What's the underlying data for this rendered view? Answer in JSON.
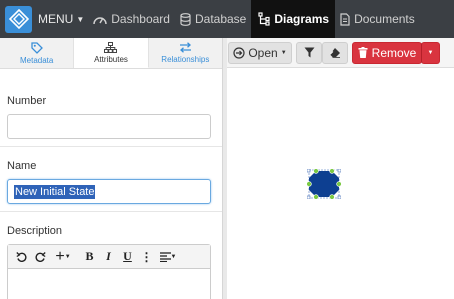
{
  "topbar": {
    "menu_label": "MENU",
    "nav": [
      {
        "label": "Dashboard",
        "icon": "dashboard-icon"
      },
      {
        "label": "Database",
        "icon": "database-icon"
      },
      {
        "label": "Diagrams",
        "icon": "diagram-icon",
        "active": true
      },
      {
        "label": "Documents",
        "icon": "document-icon"
      }
    ]
  },
  "tabs": [
    {
      "label": "Metadata",
      "icon": "tag-icon"
    },
    {
      "label": "Attributes",
      "icon": "sitemap-icon",
      "active": true
    },
    {
      "label": "Relationships",
      "icon": "exchange-icon"
    }
  ],
  "form": {
    "number_label": "Number",
    "number_value": "",
    "name_label": "Name",
    "name_value": "New Initial State",
    "description_label": "Description"
  },
  "canvas_toolbar": {
    "open_label": "Open",
    "remove_label": "Remove"
  },
  "colors": {
    "topbar": "#3b3f44",
    "accent": "#3a8fd8",
    "danger": "#d9343f",
    "shape_fill": "#0d3f91",
    "handle": "#7ac943"
  }
}
